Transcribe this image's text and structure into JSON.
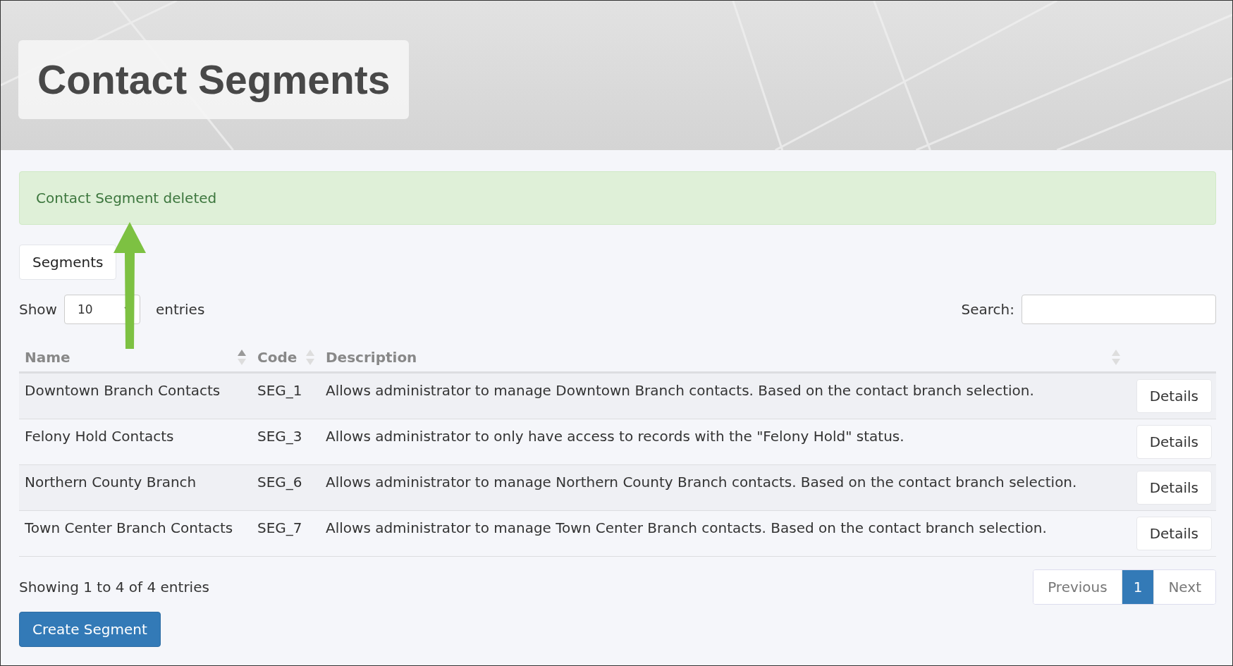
{
  "header": {
    "title": "Contact Segments"
  },
  "alert": {
    "message": "Contact Segment deleted"
  },
  "tabs": [
    {
      "label": "Segments",
      "selected": true
    }
  ],
  "length_control": {
    "label_before": "Show",
    "value": "10",
    "label_after": "entries"
  },
  "search": {
    "label": "Search:"
  },
  "table": {
    "columns": [
      {
        "label": "Name",
        "sorted": true
      },
      {
        "label": "Code",
        "sorted": false
      },
      {
        "label": "Description",
        "sorted": false
      }
    ],
    "rows": [
      {
        "name": "Downtown Branch Contacts",
        "code": "SEG_1",
        "description": "Allows administrator to manage Downtown Branch contacts. Based on the contact branch selection.",
        "action": "Details"
      },
      {
        "name": "Felony Hold Contacts",
        "code": "SEG_3",
        "description": "Allows administrator to only have access to records with the \"Felony Hold\" status.",
        "action": "Details"
      },
      {
        "name": "Northern County Branch",
        "code": "SEG_6",
        "description": "Allows administrator to manage Northern County Branch contacts. Based on the contact branch selection.",
        "action": "Details"
      },
      {
        "name": "Town Center Branch Contacts",
        "code": "SEG_7",
        "description": "Allows administrator to manage Town Center Branch contacts. Based on the contact branch selection.",
        "action": "Details"
      }
    ]
  },
  "info": "Showing 1 to 4 of 4 entries",
  "pagination": [
    {
      "label": "Previous",
      "kind": "nav",
      "disabled": true,
      "selected": false
    },
    {
      "label": "1",
      "kind": "page",
      "disabled": false,
      "selected": true
    },
    {
      "label": "Next",
      "kind": "nav",
      "disabled": true,
      "selected": false
    }
  ],
  "create_button": "Create Segment"
}
